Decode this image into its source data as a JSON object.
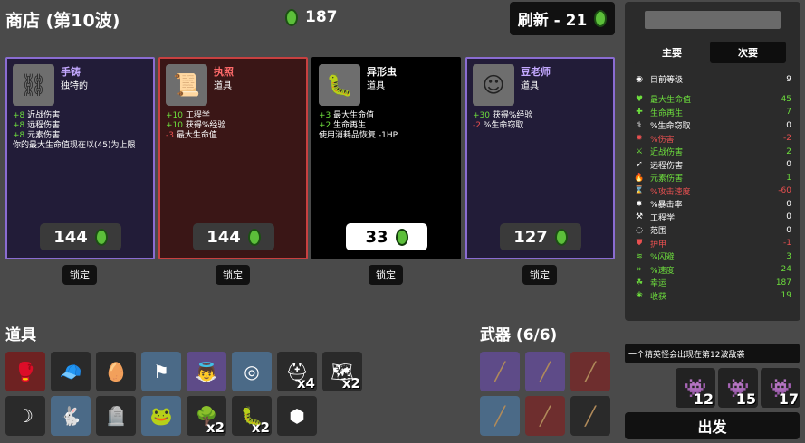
{
  "header": {
    "title": "商店 (第10波)",
    "materials": "187",
    "refresh_label": "刷新 - 21"
  },
  "shop": {
    "cards": [
      {
        "name": "手铸",
        "type": "独特的",
        "icon": "handcuffs-icon",
        "stats": [
          {
            "value": "+8",
            "text": " 近战伤害",
            "color": "g"
          },
          {
            "value": "+8",
            "text": " 远程伤害",
            "color": "g"
          },
          {
            "value": "+8",
            "text": " 元素伤害",
            "color": "g"
          },
          {
            "value": "",
            "text": "你的最大生命值现在以(45)为上限",
            "color": ""
          }
        ],
        "price": "144",
        "lock": "锁定"
      },
      {
        "name": "执照",
        "type": "道具",
        "icon": "license-scroll-icon",
        "stats": [
          {
            "value": "+10",
            "text": " 工程学",
            "color": "g"
          },
          {
            "value": "+10",
            "text": " 获得%经验",
            "color": "g"
          },
          {
            "value": "-3",
            "text": " 最大生命值",
            "color": "r"
          }
        ],
        "price": "144",
        "lock": "锁定"
      },
      {
        "name": "异形虫",
        "type": "道具",
        "icon": "alien-worm-icon",
        "stats": [
          {
            "value": "+3",
            "text": " 最大生命值",
            "color": "g"
          },
          {
            "value": "+2",
            "text": " 生命再生",
            "color": "g"
          },
          {
            "value": "",
            "text": "使用消耗品恢复 -1HP",
            "color": ""
          }
        ],
        "price": "33",
        "lock": "锁定"
      },
      {
        "name": "豆老师",
        "type": "道具",
        "icon": "bean-teacher-icon",
        "stats": [
          {
            "value": "+30",
            "text": " 获得%经验",
            "color": "g"
          },
          {
            "value": "-2",
            "text": " %生命窃取",
            "color": "r"
          }
        ],
        "price": "127",
        "lock": "锁定"
      }
    ]
  },
  "items": {
    "label": "道具",
    "slots": [
      {
        "icon": "red-glove-icon",
        "qty": "",
        "bg": "#6e2222"
      },
      {
        "icon": "propeller-hat-icon",
        "qty": "",
        "bg": "#2a2a2a"
      },
      {
        "icon": "egg-icon",
        "qty": "",
        "bg": "#2a2a2a"
      },
      {
        "icon": "white-flag-icon",
        "qty": "",
        "bg": "#4b6a87"
      },
      {
        "icon": "angel-icon",
        "qty": "",
        "bg": "#5e4b88"
      },
      {
        "icon": "red-ring-icon",
        "qty": "",
        "bg": "#4b6a87"
      },
      {
        "icon": "helmet-icon",
        "qty": "x4",
        "bg": "#2a2a2a"
      },
      {
        "icon": "map-icon",
        "qty": "x2",
        "bg": "#2a2a2a"
      },
      {
        "icon": "fang-icon",
        "qty": "",
        "bg": "#2a2a2a"
      },
      {
        "icon": "bunny-icon",
        "qty": "",
        "bg": "#4b6a87"
      },
      {
        "icon": "tombstone-icon",
        "qty": "",
        "bg": "#2a2a2a"
      },
      {
        "icon": "frog-icon",
        "qty": "",
        "bg": "#4b6a87"
      },
      {
        "icon": "tree-icon",
        "qty": "x2",
        "bg": "#2a2a2a"
      },
      {
        "icon": "alien-worm-icon",
        "qty": "x2",
        "bg": "#2a2a2a"
      },
      {
        "icon": "coal-icon",
        "qty": "",
        "bg": "#2a2a2a"
      }
    ]
  },
  "weapons": {
    "label": "武器 (6/6)",
    "slots": [
      {
        "icon": "stick-icon",
        "bg": "#5e4b88"
      },
      {
        "icon": "stick-icon",
        "bg": "#5e4b88"
      },
      {
        "icon": "stick-icon",
        "bg": "#6e2e2e"
      },
      {
        "icon": "stick-icon",
        "bg": "#4b6a87"
      },
      {
        "icon": "stick-icon",
        "bg": "#6e2e2e"
      },
      {
        "icon": "stick-icon",
        "bg": "#2a2a2a"
      }
    ]
  },
  "stats_panel": {
    "tab_primary": "主要",
    "tab_secondary": "次要",
    "level_label": "目前等级",
    "level_value": "9",
    "rows": [
      {
        "name": "最大生命值",
        "value": "45",
        "color": "#6dde3d",
        "icon": "heart-icon"
      },
      {
        "name": "生命再生",
        "value": "7",
        "color": "#6dde3d",
        "icon": "regen-icon"
      },
      {
        "name": "%生命窃取",
        "value": "0",
        "color": "#ffffff",
        "icon": "lifesteal-icon"
      },
      {
        "name": "%伤害",
        "value": "-2",
        "color": "#e85050",
        "icon": "damage-icon"
      },
      {
        "name": "近战伤害",
        "value": "2",
        "color": "#6dde3d",
        "icon": "melee-icon"
      },
      {
        "name": "远程伤害",
        "value": "0",
        "color": "#ffffff",
        "icon": "ranged-icon"
      },
      {
        "name": "元素伤害",
        "value": "1",
        "color": "#6dde3d",
        "icon": "elemental-icon"
      },
      {
        "name": "%攻击速度",
        "value": "-60",
        "color": "#e85050",
        "icon": "attack-speed-icon"
      },
      {
        "name": "%暴击率",
        "value": "0",
        "color": "#ffffff",
        "icon": "crit-icon"
      },
      {
        "name": "工程学",
        "value": "0",
        "color": "#ffffff",
        "icon": "engineering-icon"
      },
      {
        "name": "范围",
        "value": "0",
        "color": "#ffffff",
        "icon": "range-icon"
      },
      {
        "name": "护甲",
        "value": "-1",
        "color": "#e85050",
        "icon": "armor-icon"
      },
      {
        "name": "%闪避",
        "value": "3",
        "color": "#6dde3d",
        "icon": "dodge-icon"
      },
      {
        "name": "%速度",
        "value": "24",
        "color": "#6dde3d",
        "icon": "speed-icon"
      },
      {
        "name": "幸运",
        "value": "187",
        "color": "#6dde3d",
        "icon": "luck-icon"
      },
      {
        "name": "收获",
        "value": "19",
        "color": "#6dde3d",
        "icon": "harvest-icon"
      }
    ]
  },
  "wave_notice": "一个精英怪会出现在第12波敌袭",
  "enemies": [
    {
      "icon": "elite-enemy-icon",
      "qty": "12"
    },
    {
      "icon": "elite-enemy-icon",
      "qty": "15"
    },
    {
      "icon": "elite-enemy-icon",
      "qty": "17"
    }
  ],
  "go_label": "出发"
}
